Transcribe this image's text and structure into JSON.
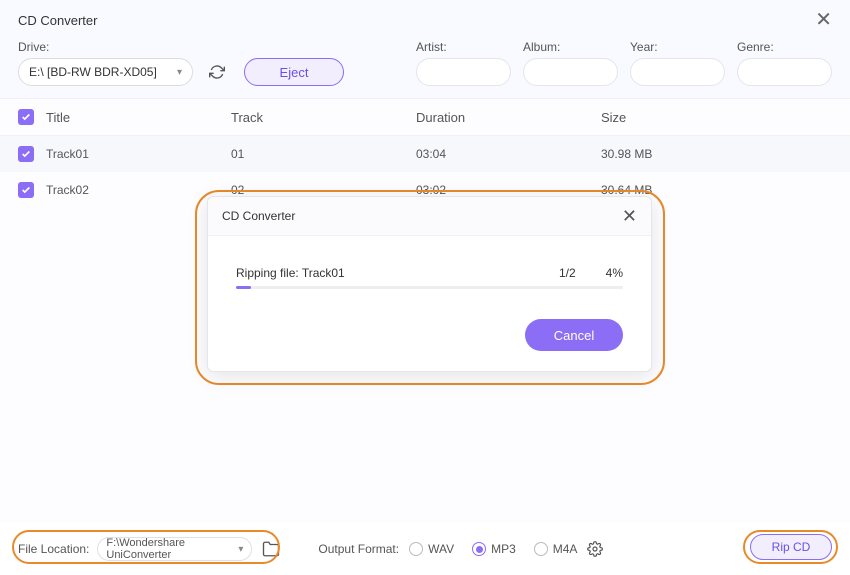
{
  "header": {
    "title": "CD Converter",
    "drive_label": "Drive:",
    "drive_value": "E:\\ [BD-RW  BDR-XD05]",
    "eject_label": "Eject",
    "meta": {
      "artist_label": "Artist:",
      "album_label": "Album:",
      "year_label": "Year:",
      "genre_label": "Genre:"
    }
  },
  "table": {
    "headers": {
      "title": "Title",
      "track": "Track",
      "duration": "Duration",
      "size": "Size"
    },
    "rows": [
      {
        "title": "Track01",
        "track": "01",
        "duration": "03:04",
        "size": "30.98 MB"
      },
      {
        "title": "Track02",
        "track": "02",
        "duration": "03:02",
        "size": "30.64 MB"
      }
    ]
  },
  "modal": {
    "title": "CD Converter",
    "ripping_text": "Ripping file: Track01",
    "count": "1/2",
    "percent": "4%",
    "cancel_label": "Cancel"
  },
  "footer": {
    "file_location_label": "File Location:",
    "file_location_value": "F:\\Wondershare UniConverter",
    "output_format_label": "Output Format:",
    "formats": {
      "wav": "WAV",
      "mp3": "MP3",
      "m4a": "M4A"
    },
    "selected_format": "MP3",
    "rip_label": "Rip CD"
  }
}
